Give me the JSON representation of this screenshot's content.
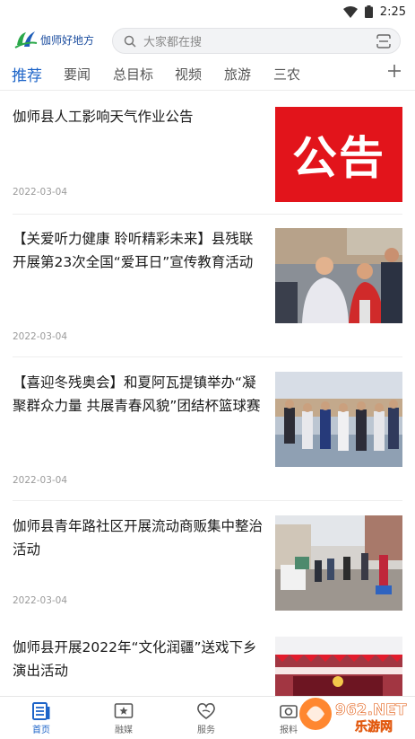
{
  "status": {
    "time": "2:25"
  },
  "header": {
    "logo_text": "伽师好地方",
    "search_placeholder": "大家都在搜"
  },
  "tabs": [
    {
      "label": "推荐",
      "active": true
    },
    {
      "label": "要闻"
    },
    {
      "label": "总目标"
    },
    {
      "label": "视频"
    },
    {
      "label": "旅游"
    },
    {
      "label": "三农"
    }
  ],
  "articles": [
    {
      "title": "伽师县人工影响天气作业公告",
      "date": "2022-03-04",
      "thumb_text": "公告"
    },
    {
      "title": "【关爱听力健康 聆听精彩未来】县残联开展第23次全国“爱耳日”宣传教育活动",
      "date": "2022-03-04"
    },
    {
      "title": "【喜迎冬残奥会】和夏阿瓦提镇举办“凝聚群众力量 共展青春风貌”团结杯篮球赛",
      "date": "2022-03-04"
    },
    {
      "title": "伽师县青年路社区开展流动商贩集中整治活动",
      "date": "2022-03-04"
    },
    {
      "title": "伽师县开展2022年“文化润疆”送戏下乡演出活动",
      "date": ""
    }
  ],
  "bottom_nav": [
    {
      "label": "首页",
      "active": true
    },
    {
      "label": "融媒"
    },
    {
      "label": "服务"
    },
    {
      "label": "报料"
    }
  ],
  "watermark": {
    "text": "962.NET",
    "sub": "乐游网"
  },
  "colors": {
    "accent": "#1d64c8",
    "notice_red": "#e2141b"
  }
}
